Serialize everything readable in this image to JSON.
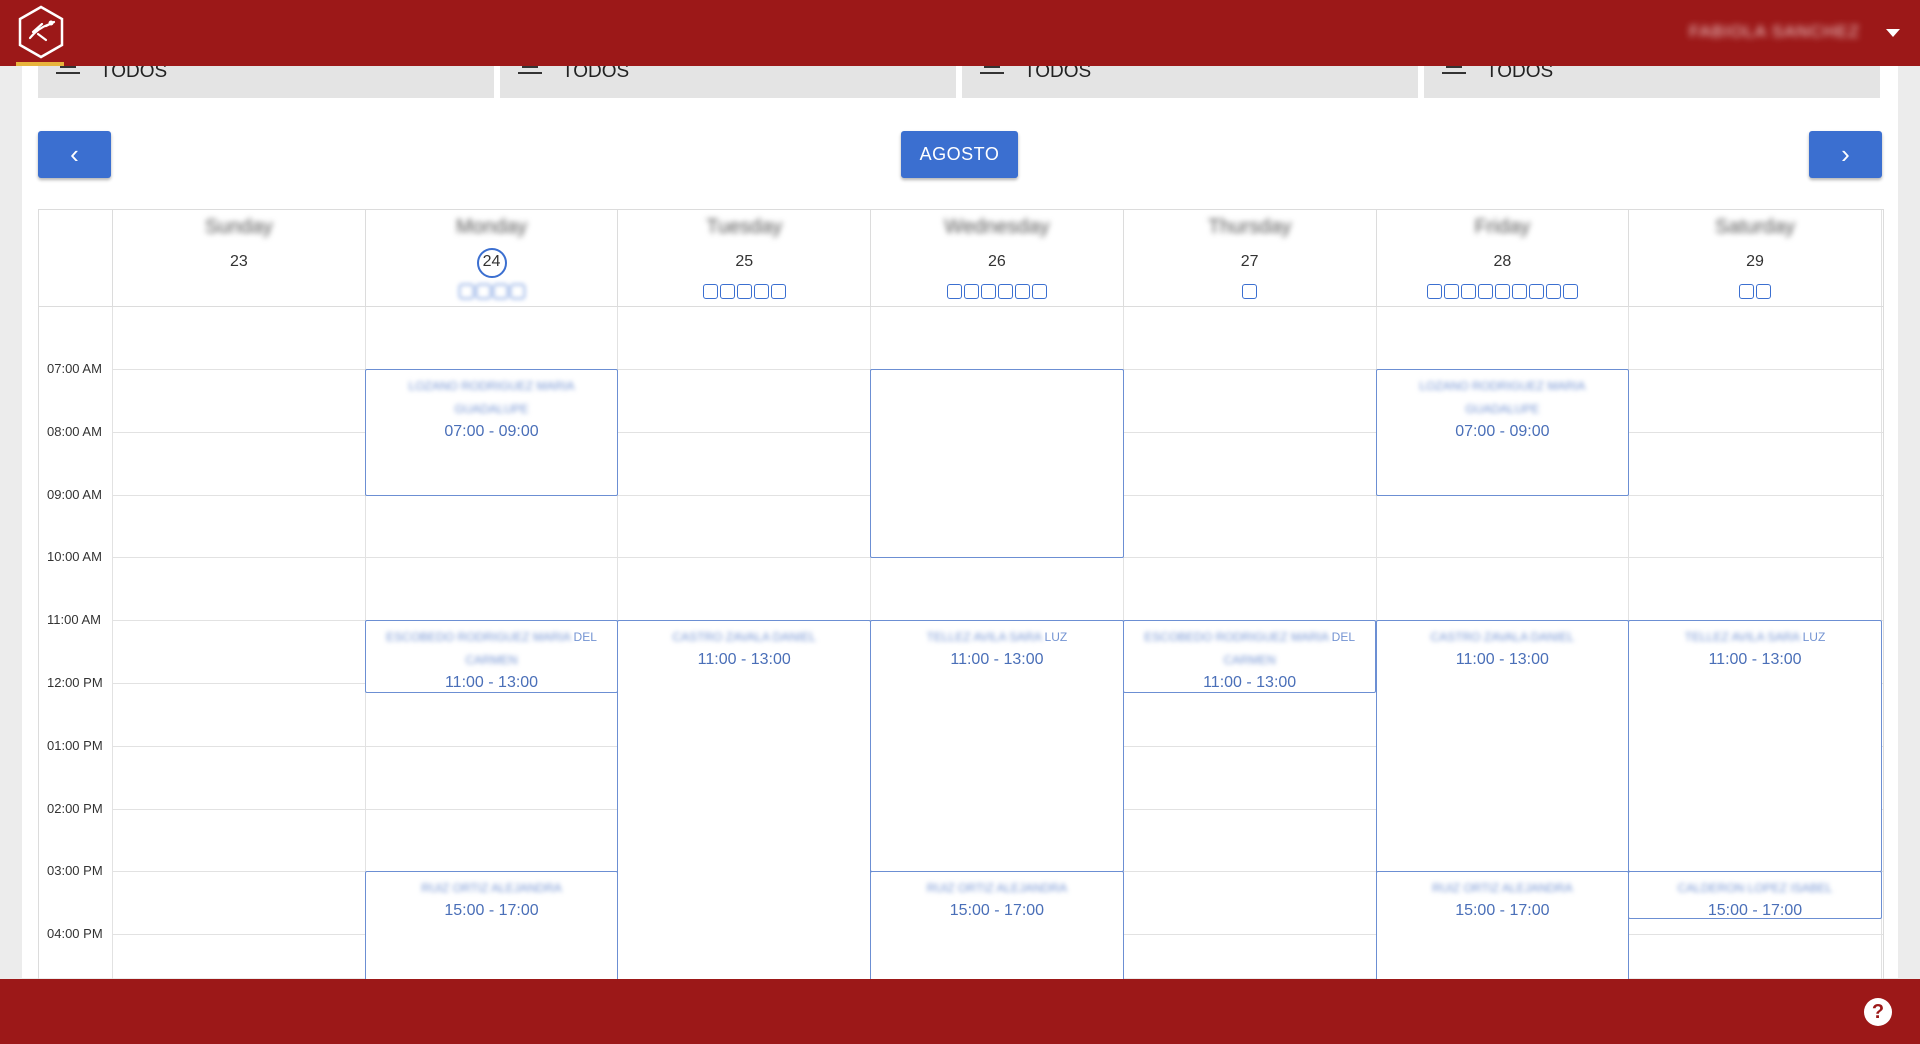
{
  "header": {
    "user_name": "FABIOLA SANCHEZ"
  },
  "filters": [
    "TODOS",
    "TODOS",
    "TODOS",
    "TODOS"
  ],
  "nav": {
    "prev": "‹",
    "next": "›",
    "month": "AGOSTO"
  },
  "days": [
    {
      "name": "Sunday",
      "num": "23",
      "ticks": 0
    },
    {
      "name": "Monday",
      "num": "24",
      "ticks": 4,
      "today": true
    },
    {
      "name": "Tuesday",
      "num": "25",
      "ticks": 5
    },
    {
      "name": "Wednesday",
      "num": "26",
      "ticks": 6
    },
    {
      "name": "Thursday",
      "num": "27",
      "ticks": 1
    },
    {
      "name": "Friday",
      "num": "28",
      "ticks": 9
    },
    {
      "name": "Saturday",
      "num": "29",
      "ticks": 2
    }
  ],
  "hours": [
    "07:00 AM",
    "08:00 AM",
    "09:00 AM",
    "10:00 AM",
    "11:00 AM",
    "12:00 PM",
    "01:00 PM",
    "02:00 PM",
    "03:00 PM",
    "04:00 PM"
  ],
  "events": [
    {
      "day": 1,
      "start": 7,
      "end": 9,
      "title": "LOZANO RODRIGUEZ MARIA GUADALUPE",
      "time": "07:00 - 09:00"
    },
    {
      "day": 3,
      "start": 7,
      "end": 9,
      "title": "LOZANO RODRIGUEZ MARIA GUADALUPE",
      "time": "07:00 - 09:00"
    },
    {
      "day": 3,
      "start": 7,
      "end": 10,
      "title": "",
      "time": ""
    },
    {
      "day": 5,
      "start": 7,
      "end": 9,
      "title": "LOZANO RODRIGUEZ MARIA GUADALUPE",
      "time": "07:00 - 09:00"
    },
    {
      "day": 1,
      "start": 11,
      "end": 12.15,
      "title": "ESCOBEDO RODRIGUEZ MARIA",
      "suffix": "DEL",
      "title2": "CARMEN",
      "time": "11:00 - 13:00"
    },
    {
      "day": 2,
      "start": 11,
      "end": 17,
      "title": "CASTRO ZAVALA DANIEL",
      "time": "11:00 - 13:00"
    },
    {
      "day": 3,
      "start": 11,
      "end": 15,
      "title": "TELLEZ AVILA SARA",
      "suffix": "LUZ",
      "time": "11:00 - 13:00"
    },
    {
      "day": 4,
      "start": 11,
      "end": 12.15,
      "title": "ESCOBEDO RODRIGUEZ MARIA",
      "suffix": "DEL",
      "title2": "CARMEN",
      "time": "11:00 - 13:00"
    },
    {
      "day": 5,
      "start": 11,
      "end": 17,
      "title": "CASTRO ZAVALA DANIEL",
      "time": "11:00 - 13:00"
    },
    {
      "day": 6,
      "start": 11,
      "end": 15,
      "title": "TELLEZ AVILA SARA",
      "suffix": "LUZ",
      "time": "11:00 - 13:00"
    },
    {
      "day": 1,
      "start": 15,
      "end": 17,
      "title": "RUIZ ORTIZ ALEJANDRA",
      "time": "15:00 - 17:00"
    },
    {
      "day": 3,
      "start": 15,
      "end": 17,
      "title": "RUIZ ORTIZ ALEJANDRA",
      "time": "15:00 - 17:00"
    },
    {
      "day": 5,
      "start": 15,
      "end": 17,
      "title": "RUIZ ORTIZ ALEJANDRA",
      "time": "15:00 - 17:00"
    },
    {
      "day": 6,
      "start": 15,
      "end": 15.75,
      "title": "CALDERON LOPEZ ISABEL",
      "time": "15:00 - 17:00"
    }
  ]
}
